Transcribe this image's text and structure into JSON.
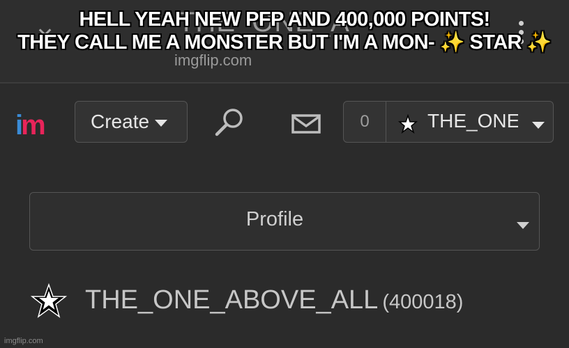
{
  "browser": {
    "tab_title": "THE_ONE_A",
    "url": "imgflip.com"
  },
  "caption": {
    "line1": "HELL YEAH NEW PFP AND 400,000 POINTS!",
    "line2": "THEY CALL ME A MONSTER BUT I'M A MON- ✨ STAR ✨"
  },
  "header": {
    "logo": {
      "part1": "i",
      "part2": "m"
    },
    "create_label": "Create",
    "notification_count": "0",
    "username": "THE_ONE_ABOVE_ALL"
  },
  "profile_menu": {
    "label": "Profile"
  },
  "profile": {
    "username": "THE_ONE_ABOVE_ALL",
    "points": "(400018)"
  },
  "watermark": "imgflip.com",
  "colors": {
    "logo_accent": "#e8245a",
    "background": "#2b2b2b"
  }
}
